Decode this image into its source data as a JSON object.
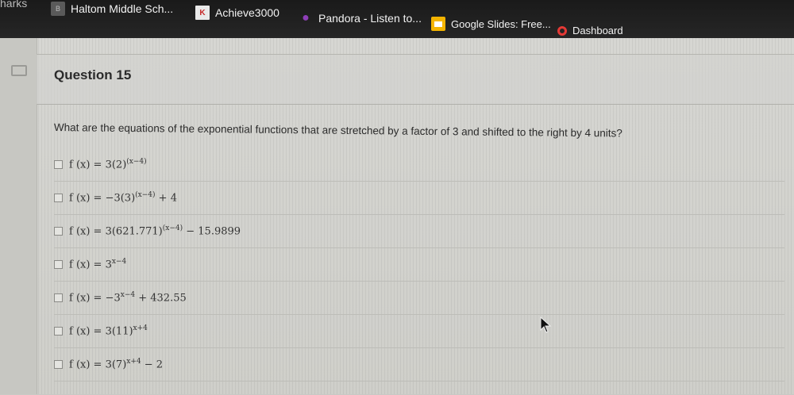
{
  "bookmarks": [
    {
      "label": "harks",
      "icon": ""
    },
    {
      "label": "Haltom Middle Sch...",
      "icon": "school-icon"
    },
    {
      "label": "Achieve3000",
      "icon": "achieve3000-icon"
    },
    {
      "label": "Pandora - Listen to...",
      "icon": "pandora-icon"
    },
    {
      "label": "Google Slides: Free...",
      "icon": "google-slides-icon"
    },
    {
      "label": "Dashboard",
      "icon": "dashboard-icon"
    }
  ],
  "question": {
    "title": "Question 15",
    "prompt": "What are the equations of the exponential functions that are stretched by a factor of 3 and shifted to the right by 4 units?",
    "options": [
      {
        "prefix": "f (x) = 3(2)",
        "exp": "(x−4)",
        "suffix": ""
      },
      {
        "prefix": "f (x) = −3(3)",
        "exp": "(x−4)",
        "suffix": " + 4"
      },
      {
        "prefix": "f (x) = 3(621.771)",
        "exp": "(x−4)",
        "suffix": " − 15.9899"
      },
      {
        "prefix": "f (x) = 3",
        "exp": "x−4",
        "suffix": ""
      },
      {
        "prefix": "f (x) = −3",
        "exp": "x−4",
        "suffix": " + 432.55"
      },
      {
        "prefix": "f (x) = 3(11)",
        "exp": "x+4",
        "suffix": ""
      },
      {
        "prefix": "f (x) = 3(7)",
        "exp": "x+4",
        "suffix": " − 2"
      }
    ]
  }
}
